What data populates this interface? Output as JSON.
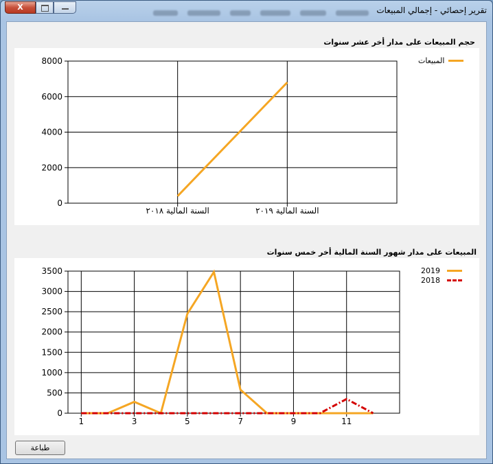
{
  "window": {
    "title": "تقرير إحصائي - إجمالي المبيعات",
    "close_label": "X"
  },
  "chart1": {
    "title": "حجم المبيعات على مدار أخر عشر سنوات"
  },
  "chart2": {
    "title": "المبيعات على مدار شهور السنة المالية أخر خمس سنوات"
  },
  "print_button": {
    "label": "طباعة"
  },
  "colors": {
    "series_orange": "#f5a623",
    "series_red": "#d40000"
  },
  "chart_data": [
    {
      "type": "line",
      "title": "حجم المبيعات على مدار أخر عشر سنوات",
      "categories": [
        "السنة المالية ٢٠١٨",
        "السنة المالية ٢٠١٩"
      ],
      "series": [
        {
          "name": "المبيعات",
          "color": "#f5a623",
          "values": [
            400,
            6800
          ]
        }
      ],
      "ylim": [
        0,
        8000
      ],
      "yticks": [
        0,
        2000,
        4000,
        6000,
        8000
      ],
      "grid": true,
      "legend": "top-right"
    },
    {
      "type": "line",
      "title": "المبيعات على مدار شهور السنة المالية أخر خمس سنوات",
      "x": [
        1,
        2,
        3,
        4,
        5,
        6,
        7,
        8,
        9,
        10,
        11,
        12
      ],
      "xticks": [
        1,
        3,
        5,
        7,
        9,
        11
      ],
      "series": [
        {
          "name": "2019",
          "color": "#f5a623",
          "dash": "solid",
          "values": [
            0,
            0,
            280,
            0,
            2450,
            3480,
            580,
            0,
            0,
            0,
            0,
            0
          ]
        },
        {
          "name": "2018",
          "color": "#d40000",
          "dash": "dashdot",
          "values": [
            0,
            0,
            0,
            0,
            0,
            0,
            0,
            0,
            0,
            0,
            350,
            0
          ]
        }
      ],
      "ylim": [
        0,
        3500
      ],
      "yticks": [
        0,
        500,
        1000,
        1500,
        2000,
        2500,
        3000,
        3500
      ],
      "grid": true,
      "legend": "top-right"
    }
  ]
}
